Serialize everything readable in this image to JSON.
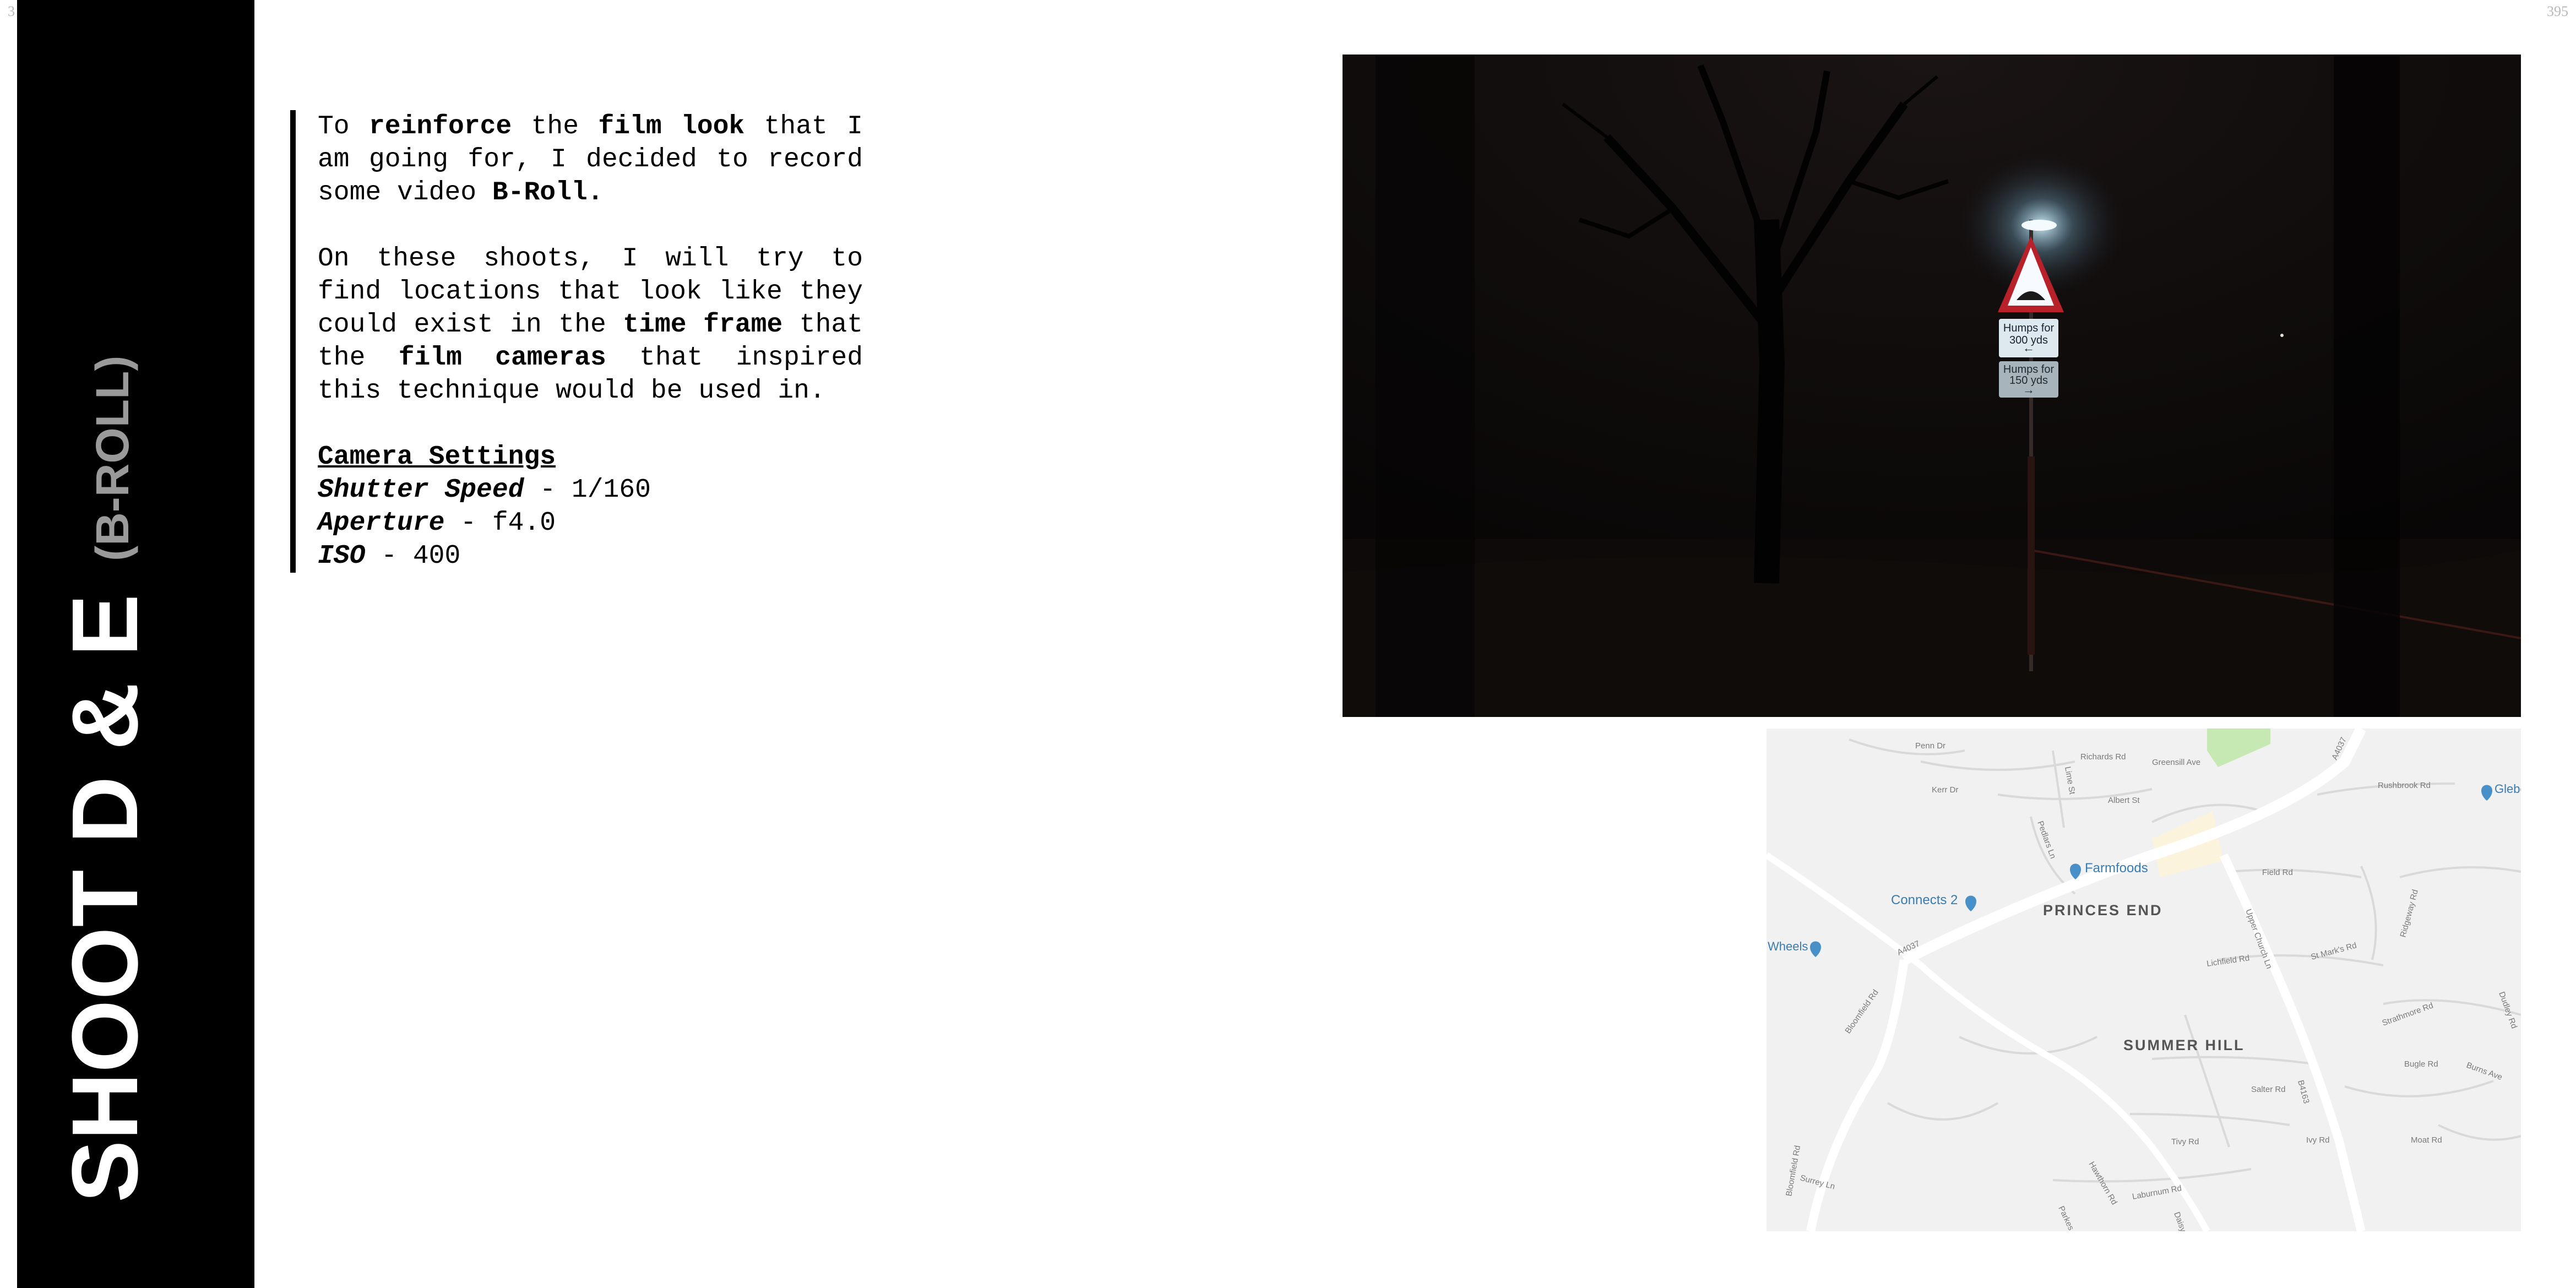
{
  "page_numbers": {
    "left": "3",
    "right": "395"
  },
  "sidebar": {
    "title": "SHOOT D & E",
    "subtitle": "(B-ROLL)"
  },
  "intro": {
    "t1": "To ",
    "b1": "reinforce",
    "t2": " the ",
    "b2": "film look",
    "t3": " that I am going for, I decided to record some video ",
    "b3": "B-Roll."
  },
  "para2": {
    "t1": "On these shoots, I will try to find locations that look like they could exist in the ",
    "b1": "time frame",
    "t2": " that the ",
    "b2": "film cameras",
    "t3": " that inspired this technique would be used in."
  },
  "camera_settings": {
    "heading": "Camera Settings",
    "items": [
      {
        "name": "Shutter Speed",
        "value": " - 1/160"
      },
      {
        "name": "Aperture",
        "value": " - f4.0"
      },
      {
        "name": "ISO",
        "value": " - 400"
      }
    ]
  },
  "photo": {
    "sign_top": "Humps for",
    "sign_top2": "300 yds",
    "sign_bottom": "Humps for",
    "sign_bottom2": "150 yds"
  },
  "map": {
    "areas": [
      "PRINCES END",
      "SUMMER HILL"
    ],
    "places": [
      "Farmfoods",
      "Connects 2",
      "Wheels",
      "Glebe Prim"
    ],
    "roads": [
      "A4037",
      "A4037",
      "Bloomfield Rd",
      "Bloomfield Rd",
      "Upper Church Ln",
      "B4163",
      "Field Rd",
      "St Mark's Rd",
      "Lichfield Rd",
      "Albert St",
      "Richards Rd",
      "Greensill Ave",
      "Penn Dr",
      "Kerr Dr",
      "Lime St",
      "Pedlars Ln",
      "Ridgeway Rd",
      "Rushbrook Rd",
      "Tivy Rd",
      "Salter Rd",
      "Laburnum Rd",
      "Parkes Ave",
      "Hawthorn Rd",
      "Bugle Rd",
      "Ivy Rd",
      "Moat Rd",
      "Burns Ave",
      "Strathmore Rd",
      "Surrey Ln",
      "Daisy Rd",
      "Dudley Rd"
    ]
  }
}
